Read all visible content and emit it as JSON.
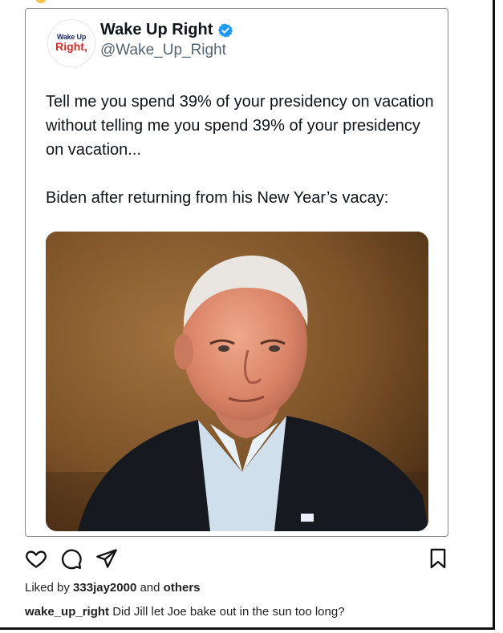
{
  "tweet": {
    "avatar": {
      "line1": "Wake Up",
      "line2": "Right",
      "line2_accent": ","
    },
    "display_name": "Wake Up Right",
    "handle": "@Wake_Up_Right",
    "verified_icon": "verified-badge-icon",
    "text": "Tell me you spend 39% of your presidency on vacation without telling me you spend 39% of your presidency on vacation...\n\nBiden after returning from his New Year’s vacay:",
    "image_alt": "photo"
  },
  "post_actions": {
    "like_icon": "heart-icon",
    "comment_icon": "comment-icon",
    "share_icon": "send-icon",
    "save_icon": "bookmark-icon"
  },
  "likes": {
    "prefix": "Liked by",
    "user": "333jay2000",
    "joiner": "and",
    "others": "others"
  },
  "caption": {
    "username": "wake_up_right",
    "text": "Did Jill let Joe bake out in the sun too long?"
  },
  "colors": {
    "verified": "#1d9bf0",
    "accent_red": "#d62b2b",
    "handle_gray": "#536471"
  }
}
